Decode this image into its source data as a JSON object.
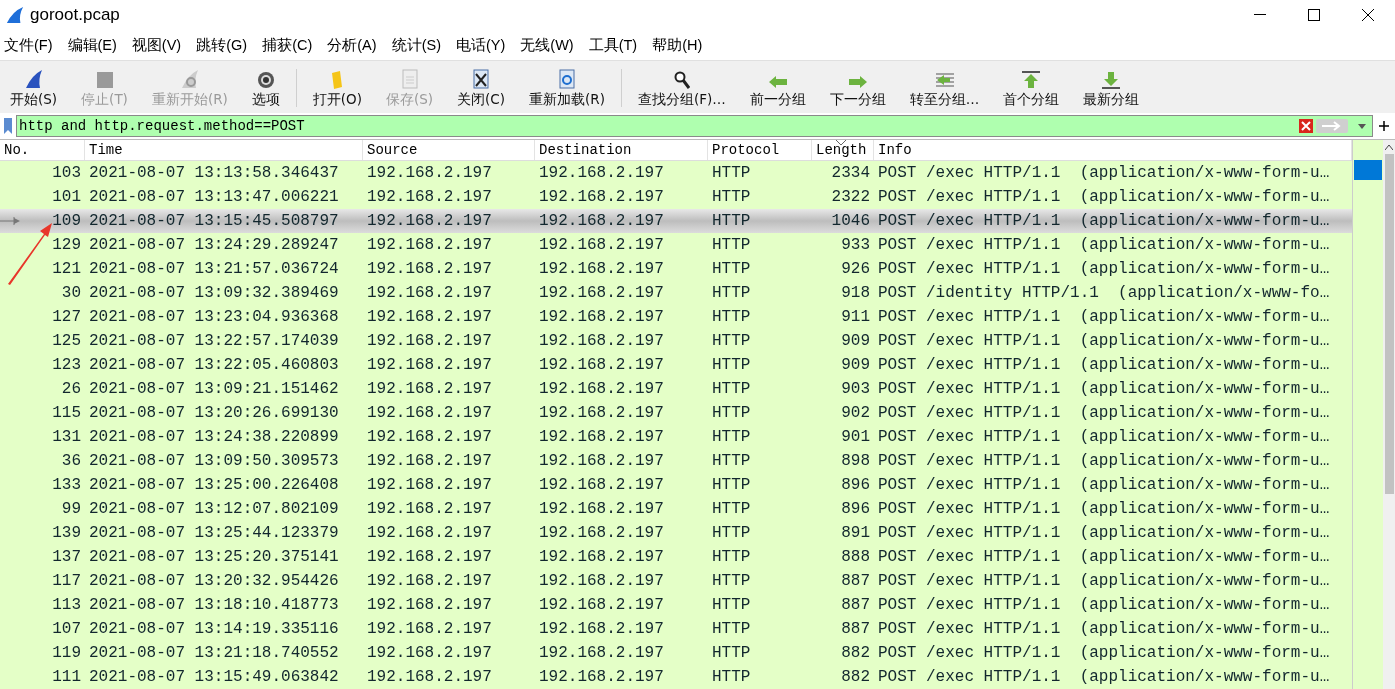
{
  "window": {
    "title": "goroot.pcap"
  },
  "menu": [
    "文件(F)",
    "编辑(E)",
    "视图(V)",
    "跳转(G)",
    "捕获(C)",
    "分析(A)",
    "统计(S)",
    "电话(Y)",
    "无线(W)",
    "工具(T)",
    "帮助(H)"
  ],
  "toolbar": [
    {
      "kind": "fin",
      "label": "开始(S)",
      "disabled": false
    },
    {
      "kind": "stop",
      "label": "停止(T)",
      "disabled": true
    },
    {
      "kind": "restart",
      "label": "重新开始(R)",
      "disabled": true
    },
    {
      "kind": "gear",
      "label": "选项",
      "disabled": false
    },
    {
      "kind": "sep"
    },
    {
      "kind": "folder",
      "label": "打开(O)",
      "disabled": false
    },
    {
      "kind": "save",
      "label": "保存(S)",
      "disabled": true
    },
    {
      "kind": "close",
      "label": "关闭(C)",
      "disabled": false
    },
    {
      "kind": "reload",
      "label": "重新加载(R)",
      "disabled": false
    },
    {
      "kind": "sep"
    },
    {
      "kind": "search",
      "label": "查找分组(F)…",
      "disabled": false
    },
    {
      "kind": "left",
      "label": "前一分组",
      "disabled": false
    },
    {
      "kind": "right",
      "label": "下一分组",
      "disabled": false
    },
    {
      "kind": "goto",
      "label": "转至分组…",
      "disabled": false
    },
    {
      "kind": "first",
      "label": "首个分组",
      "disabled": false
    },
    {
      "kind": "last",
      "label": "最新分组",
      "disabled": false
    }
  ],
  "filter": {
    "value": "http and http.request.method==POST"
  },
  "table": {
    "columns": [
      {
        "label": "No.",
        "sorted": false
      },
      {
        "label": "Time",
        "sorted": false
      },
      {
        "label": "Source",
        "sorted": false
      },
      {
        "label": "Destination",
        "sorted": false
      },
      {
        "label": "Protocol",
        "sorted": false
      },
      {
        "label": "Length",
        "sorted": true
      },
      {
        "label": "Info",
        "sorted": false
      }
    ],
    "rows": [
      {
        "no": "103",
        "time": "2021-08-07 13:13:58.346437",
        "source": "192.168.2.197",
        "destination": "192.168.2.197",
        "protocol": "HTTP",
        "length": "2334",
        "info": "POST /exec HTTP/1.1  (application/x-www-form-u…",
        "selected": false
      },
      {
        "no": "101",
        "time": "2021-08-07 13:13:47.006221",
        "source": "192.168.2.197",
        "destination": "192.168.2.197",
        "protocol": "HTTP",
        "length": "2322",
        "info": "POST /exec HTTP/1.1  (application/x-www-form-u…",
        "selected": false
      },
      {
        "no": "109",
        "time": "2021-08-07 13:15:45.508797",
        "source": "192.168.2.197",
        "destination": "192.168.2.197",
        "protocol": "HTTP",
        "length": "1046",
        "info": "POST /exec HTTP/1.1  (application/x-www-form-u…",
        "selected": true
      },
      {
        "no": "129",
        "time": "2021-08-07 13:24:29.289247",
        "source": "192.168.2.197",
        "destination": "192.168.2.197",
        "protocol": "HTTP",
        "length": "933",
        "info": "POST /exec HTTP/1.1  (application/x-www-form-u…",
        "selected": false
      },
      {
        "no": "121",
        "time": "2021-08-07 13:21:57.036724",
        "source": "192.168.2.197",
        "destination": "192.168.2.197",
        "protocol": "HTTP",
        "length": "926",
        "info": "POST /exec HTTP/1.1  (application/x-www-form-u…",
        "selected": false
      },
      {
        "no": "30",
        "time": "2021-08-07 13:09:32.389469",
        "source": "192.168.2.197",
        "destination": "192.168.2.197",
        "protocol": "HTTP",
        "length": "918",
        "info": "POST /identity HTTP/1.1  (application/x-www-fo…",
        "selected": false
      },
      {
        "no": "127",
        "time": "2021-08-07 13:23:04.936368",
        "source": "192.168.2.197",
        "destination": "192.168.2.197",
        "protocol": "HTTP",
        "length": "911",
        "info": "POST /exec HTTP/1.1  (application/x-www-form-u…",
        "selected": false
      },
      {
        "no": "125",
        "time": "2021-08-07 13:22:57.174039",
        "source": "192.168.2.197",
        "destination": "192.168.2.197",
        "protocol": "HTTP",
        "length": "909",
        "info": "POST /exec HTTP/1.1  (application/x-www-form-u…",
        "selected": false
      },
      {
        "no": "123",
        "time": "2021-08-07 13:22:05.460803",
        "source": "192.168.2.197",
        "destination": "192.168.2.197",
        "protocol": "HTTP",
        "length": "909",
        "info": "POST /exec HTTP/1.1  (application/x-www-form-u…",
        "selected": false
      },
      {
        "no": "26",
        "time": "2021-08-07 13:09:21.151462",
        "source": "192.168.2.197",
        "destination": "192.168.2.197",
        "protocol": "HTTP",
        "length": "903",
        "info": "POST /exec HTTP/1.1  (application/x-www-form-u…",
        "selected": false
      },
      {
        "no": "115",
        "time": "2021-08-07 13:20:26.699130",
        "source": "192.168.2.197",
        "destination": "192.168.2.197",
        "protocol": "HTTP",
        "length": "902",
        "info": "POST /exec HTTP/1.1  (application/x-www-form-u…",
        "selected": false
      },
      {
        "no": "131",
        "time": "2021-08-07 13:24:38.220899",
        "source": "192.168.2.197",
        "destination": "192.168.2.197",
        "protocol": "HTTP",
        "length": "901",
        "info": "POST /exec HTTP/1.1  (application/x-www-form-u…",
        "selected": false
      },
      {
        "no": "36",
        "time": "2021-08-07 13:09:50.309573",
        "source": "192.168.2.197",
        "destination": "192.168.2.197",
        "protocol": "HTTP",
        "length": "898",
        "info": "POST /exec HTTP/1.1  (application/x-www-form-u…",
        "selected": false
      },
      {
        "no": "133",
        "time": "2021-08-07 13:25:00.226408",
        "source": "192.168.2.197",
        "destination": "192.168.2.197",
        "protocol": "HTTP",
        "length": "896",
        "info": "POST /exec HTTP/1.1  (application/x-www-form-u…",
        "selected": false
      },
      {
        "no": "99",
        "time": "2021-08-07 13:12:07.802109",
        "source": "192.168.2.197",
        "destination": "192.168.2.197",
        "protocol": "HTTP",
        "length": "896",
        "info": "POST /exec HTTP/1.1  (application/x-www-form-u…",
        "selected": false
      },
      {
        "no": "139",
        "time": "2021-08-07 13:25:44.123379",
        "source": "192.168.2.197",
        "destination": "192.168.2.197",
        "protocol": "HTTP",
        "length": "891",
        "info": "POST /exec HTTP/1.1  (application/x-www-form-u…",
        "selected": false
      },
      {
        "no": "137",
        "time": "2021-08-07 13:25:20.375141",
        "source": "192.168.2.197",
        "destination": "192.168.2.197",
        "protocol": "HTTP",
        "length": "888",
        "info": "POST /exec HTTP/1.1  (application/x-www-form-u…",
        "selected": false
      },
      {
        "no": "117",
        "time": "2021-08-07 13:20:32.954426",
        "source": "192.168.2.197",
        "destination": "192.168.2.197",
        "protocol": "HTTP",
        "length": "887",
        "info": "POST /exec HTTP/1.1  (application/x-www-form-u…",
        "selected": false
      },
      {
        "no": "113",
        "time": "2021-08-07 13:18:10.418773",
        "source": "192.168.2.197",
        "destination": "192.168.2.197",
        "protocol": "HTTP",
        "length": "887",
        "info": "POST /exec HTTP/1.1  (application/x-www-form-u…",
        "selected": false
      },
      {
        "no": "107",
        "time": "2021-08-07 13:14:19.335116",
        "source": "192.168.2.197",
        "destination": "192.168.2.197",
        "protocol": "HTTP",
        "length": "887",
        "info": "POST /exec HTTP/1.1  (application/x-www-form-u…",
        "selected": false
      },
      {
        "no": "119",
        "time": "2021-08-07 13:21:18.740552",
        "source": "192.168.2.197",
        "destination": "192.168.2.197",
        "protocol": "HTTP",
        "length": "882",
        "info": "POST /exec HTTP/1.1  (application/x-www-form-u…",
        "selected": false
      },
      {
        "no": "111",
        "time": "2021-08-07 13:15:49.063842",
        "source": "192.168.2.197",
        "destination": "192.168.2.197",
        "protocol": "HTTP",
        "length": "882",
        "info": "POST /exec HTTP/1.1  (application/x-www-form-u…",
        "selected": false
      }
    ]
  }
}
